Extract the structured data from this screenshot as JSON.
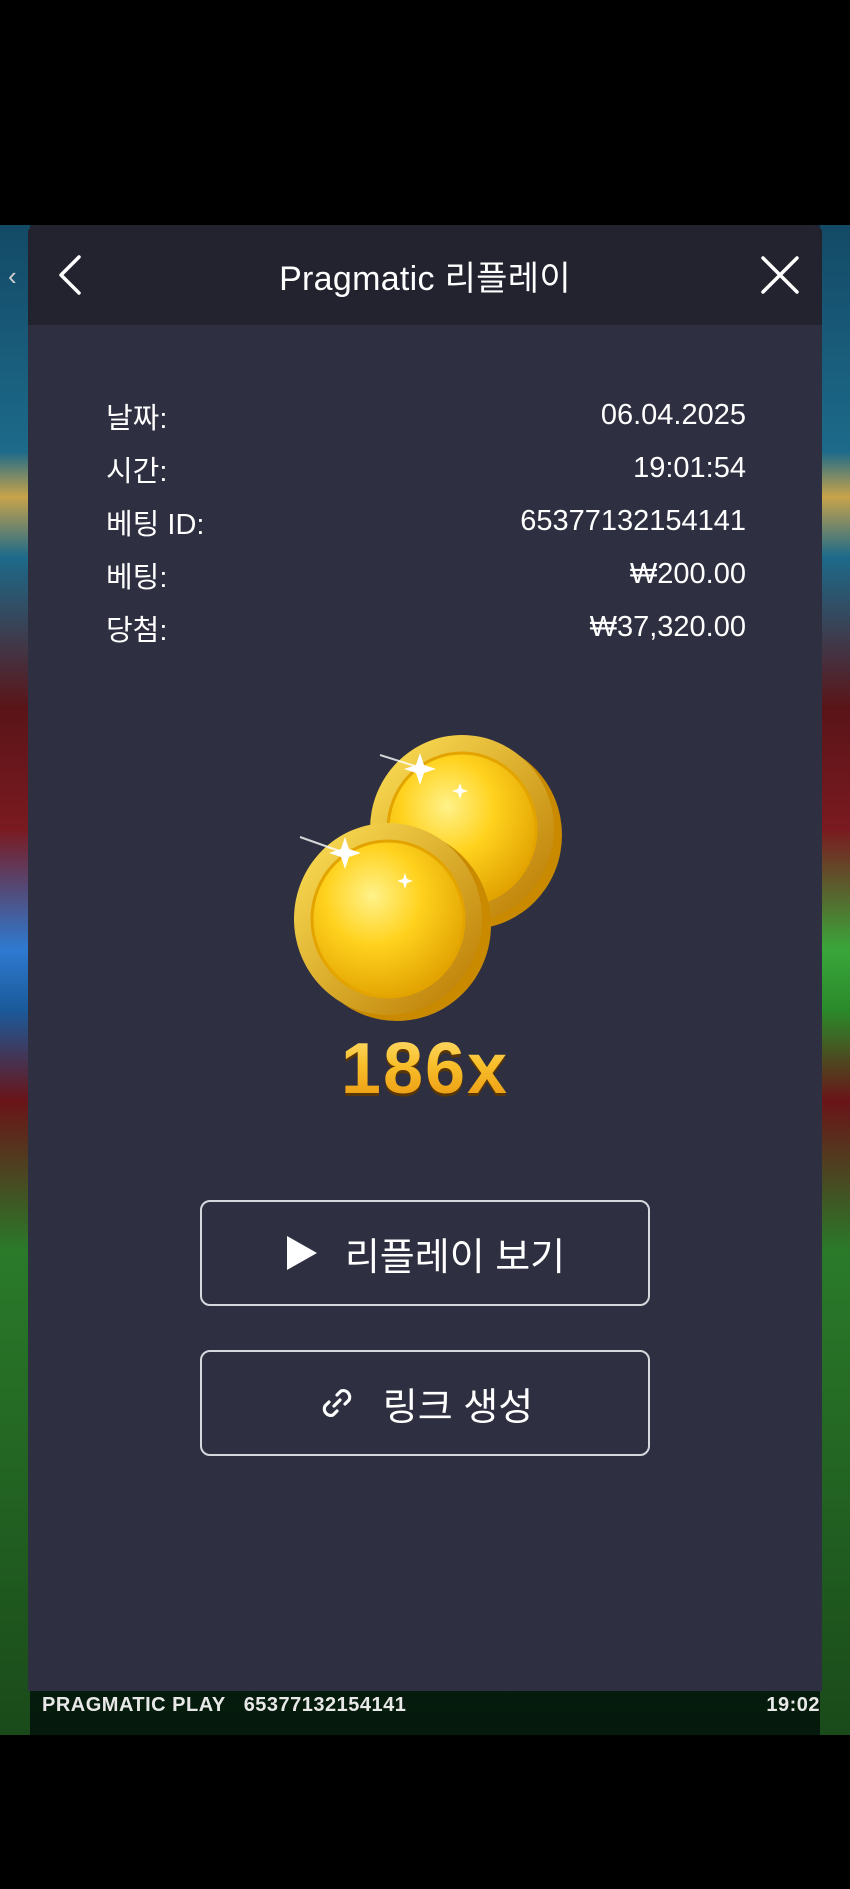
{
  "header": {
    "title": "Pragmatic 리플레이",
    "back_icon": "chevron-left-icon",
    "close_icon": "close-icon"
  },
  "details": [
    {
      "label": "날짜:",
      "value": "06.04.2025"
    },
    {
      "label": "시간:",
      "value": "19:01:54"
    },
    {
      "label": "베팅 ID:",
      "value": "65377132154141"
    },
    {
      "label": "베팅:",
      "value": "₩200.00"
    },
    {
      "label": "당첨:",
      "value": "₩37,320.00"
    }
  ],
  "win": {
    "multiplier": "186x",
    "icon": "gold-coins-icon"
  },
  "actions": {
    "replay_label": "리플레이 보기",
    "replay_icon": "play-icon",
    "link_label": "링크 생성",
    "link_icon": "link-icon"
  },
  "game_footer": {
    "provider": "PRAGMATIC PLAY",
    "bet_id": "65377132154141",
    "clock": "19:02"
  },
  "colors": {
    "modal_bg": "#2e2f40",
    "header_bg": "#22232f",
    "accent_gold": "#f5b21c"
  }
}
